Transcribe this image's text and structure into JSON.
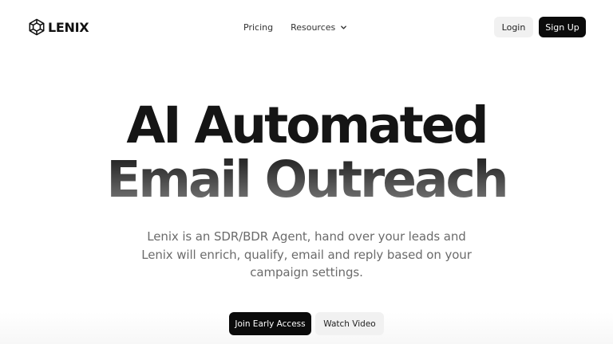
{
  "header": {
    "logo": {
      "text": "LENIX",
      "icon": "hexagon-cube-logo-icon"
    },
    "nav": {
      "pricing_label": "Pricing",
      "resources_label": "Resources",
      "resources_icon": "chevron-down-icon"
    },
    "login_label": "Login",
    "signup_label": "Sign Up"
  },
  "hero": {
    "title_line1": "AI Automated",
    "title_line2": "Email Outreach",
    "description": "Lenix is an SDR/BDR Agent, hand over your leads and Lenix will enrich, qualify, email and reply based on your campaign settings.",
    "cta_primary_label": "Join Early Access",
    "cta_secondary_label": "Watch Video"
  },
  "colors": {
    "primary_button": "#0b0b0b",
    "secondary_button": "#f1f1f1",
    "text_dark": "#151515",
    "text_muted": "#6b6b6b"
  }
}
